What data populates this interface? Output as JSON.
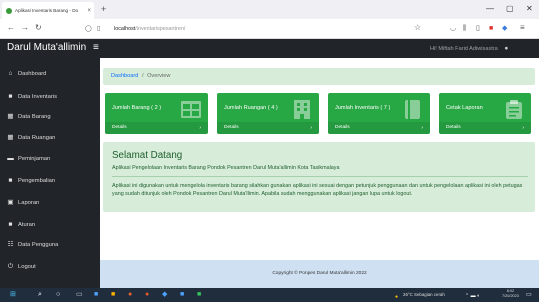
{
  "browser": {
    "tab_title": "Aplikasi Inventaris Barang - Do",
    "url_host": "localhost",
    "url_path": "/inventarispesantren/",
    "new_tab": "+",
    "minimize": "—",
    "maximize": "▢",
    "close": "✕"
  },
  "app": {
    "brand": "Darul Muta'allimin",
    "menu_toggle": "≡",
    "greeting": "Hi! Miftah Farid Adiwisastra",
    "user_icon": "user-icon"
  },
  "sidebar": {
    "items": [
      {
        "icon": "⌂",
        "icon_name": "home-icon",
        "label": "Dashboard"
      },
      {
        "icon": "■",
        "icon_name": "file-icon",
        "label": "Data Inventaris"
      },
      {
        "icon": "▦",
        "icon_name": "table-icon",
        "label": "Data Barang"
      },
      {
        "icon": "▦",
        "icon_name": "table-icon",
        "label": "Data Ruangan"
      },
      {
        "icon": "▬",
        "icon_name": "bag-icon",
        "label": "Peminjaman"
      },
      {
        "icon": "■",
        "icon_name": "file-icon",
        "label": "Pengembalian"
      },
      {
        "icon": "▣",
        "icon_name": "print-icon",
        "label": "Laporan"
      },
      {
        "icon": "■",
        "icon_name": "book-icon",
        "label": "Aturan"
      },
      {
        "icon": "☷",
        "icon_name": "users-icon",
        "label": "Data Pengguna"
      },
      {
        "icon": "⏻",
        "icon_name": "power-icon",
        "label": "Logout"
      }
    ]
  },
  "breadcrumb": {
    "link": "Dashboard",
    "separator": "/",
    "current": "Overview"
  },
  "cards": [
    {
      "title": "Jumlah Barang ( 2 )",
      "detail": "Details",
      "arrow": "›",
      "icon_name": "table-icon"
    },
    {
      "title": "Jumlah Ruangan ( 4 )",
      "detail": "Details",
      "arrow": "›",
      "icon_name": "building-icon"
    },
    {
      "title": "Jumlah Inventaris ( 7 )",
      "detail": "Details",
      "arrow": "›",
      "icon_name": "book-icon"
    },
    {
      "title": "Cetak Laporan",
      "detail": "Details",
      "arrow": "›",
      "icon_name": "clipboard-icon"
    }
  ],
  "welcome": {
    "title": "Selamat Datang",
    "subtitle": "Aplikasi Pengelolaan Inventaris Barang Pondok Pesantren Darul Muta'allimin Kota Tasikmalaya",
    "body": "Aplikasi ini digunakan untuk mengelola inventaris barang silahkan gunakan aplikasi ini sesuai dengan petunjuk penggunaan dan untuk pengelolaan aplikasi ini oleh petugas yang sudah ditunjuk oleh Pondok Pesantren Darul Muta'llimin. Apabila sudah menggunakan aplikasi jangan lupa untuk logout."
  },
  "footer": {
    "text": "Copyright © Ponpes Darul Muta'allimin 2022"
  },
  "taskbar": {
    "weather": "26°C  Sebagian cerah",
    "time": "8:02",
    "date": "7/20/2023"
  },
  "colors": {
    "card_green": "#28a745",
    "sidebar_dark": "#212529",
    "welcome_bg": "#d7edd9",
    "footer_bg": "#cfe0f2",
    "taskbar": "#1f2d3d"
  }
}
